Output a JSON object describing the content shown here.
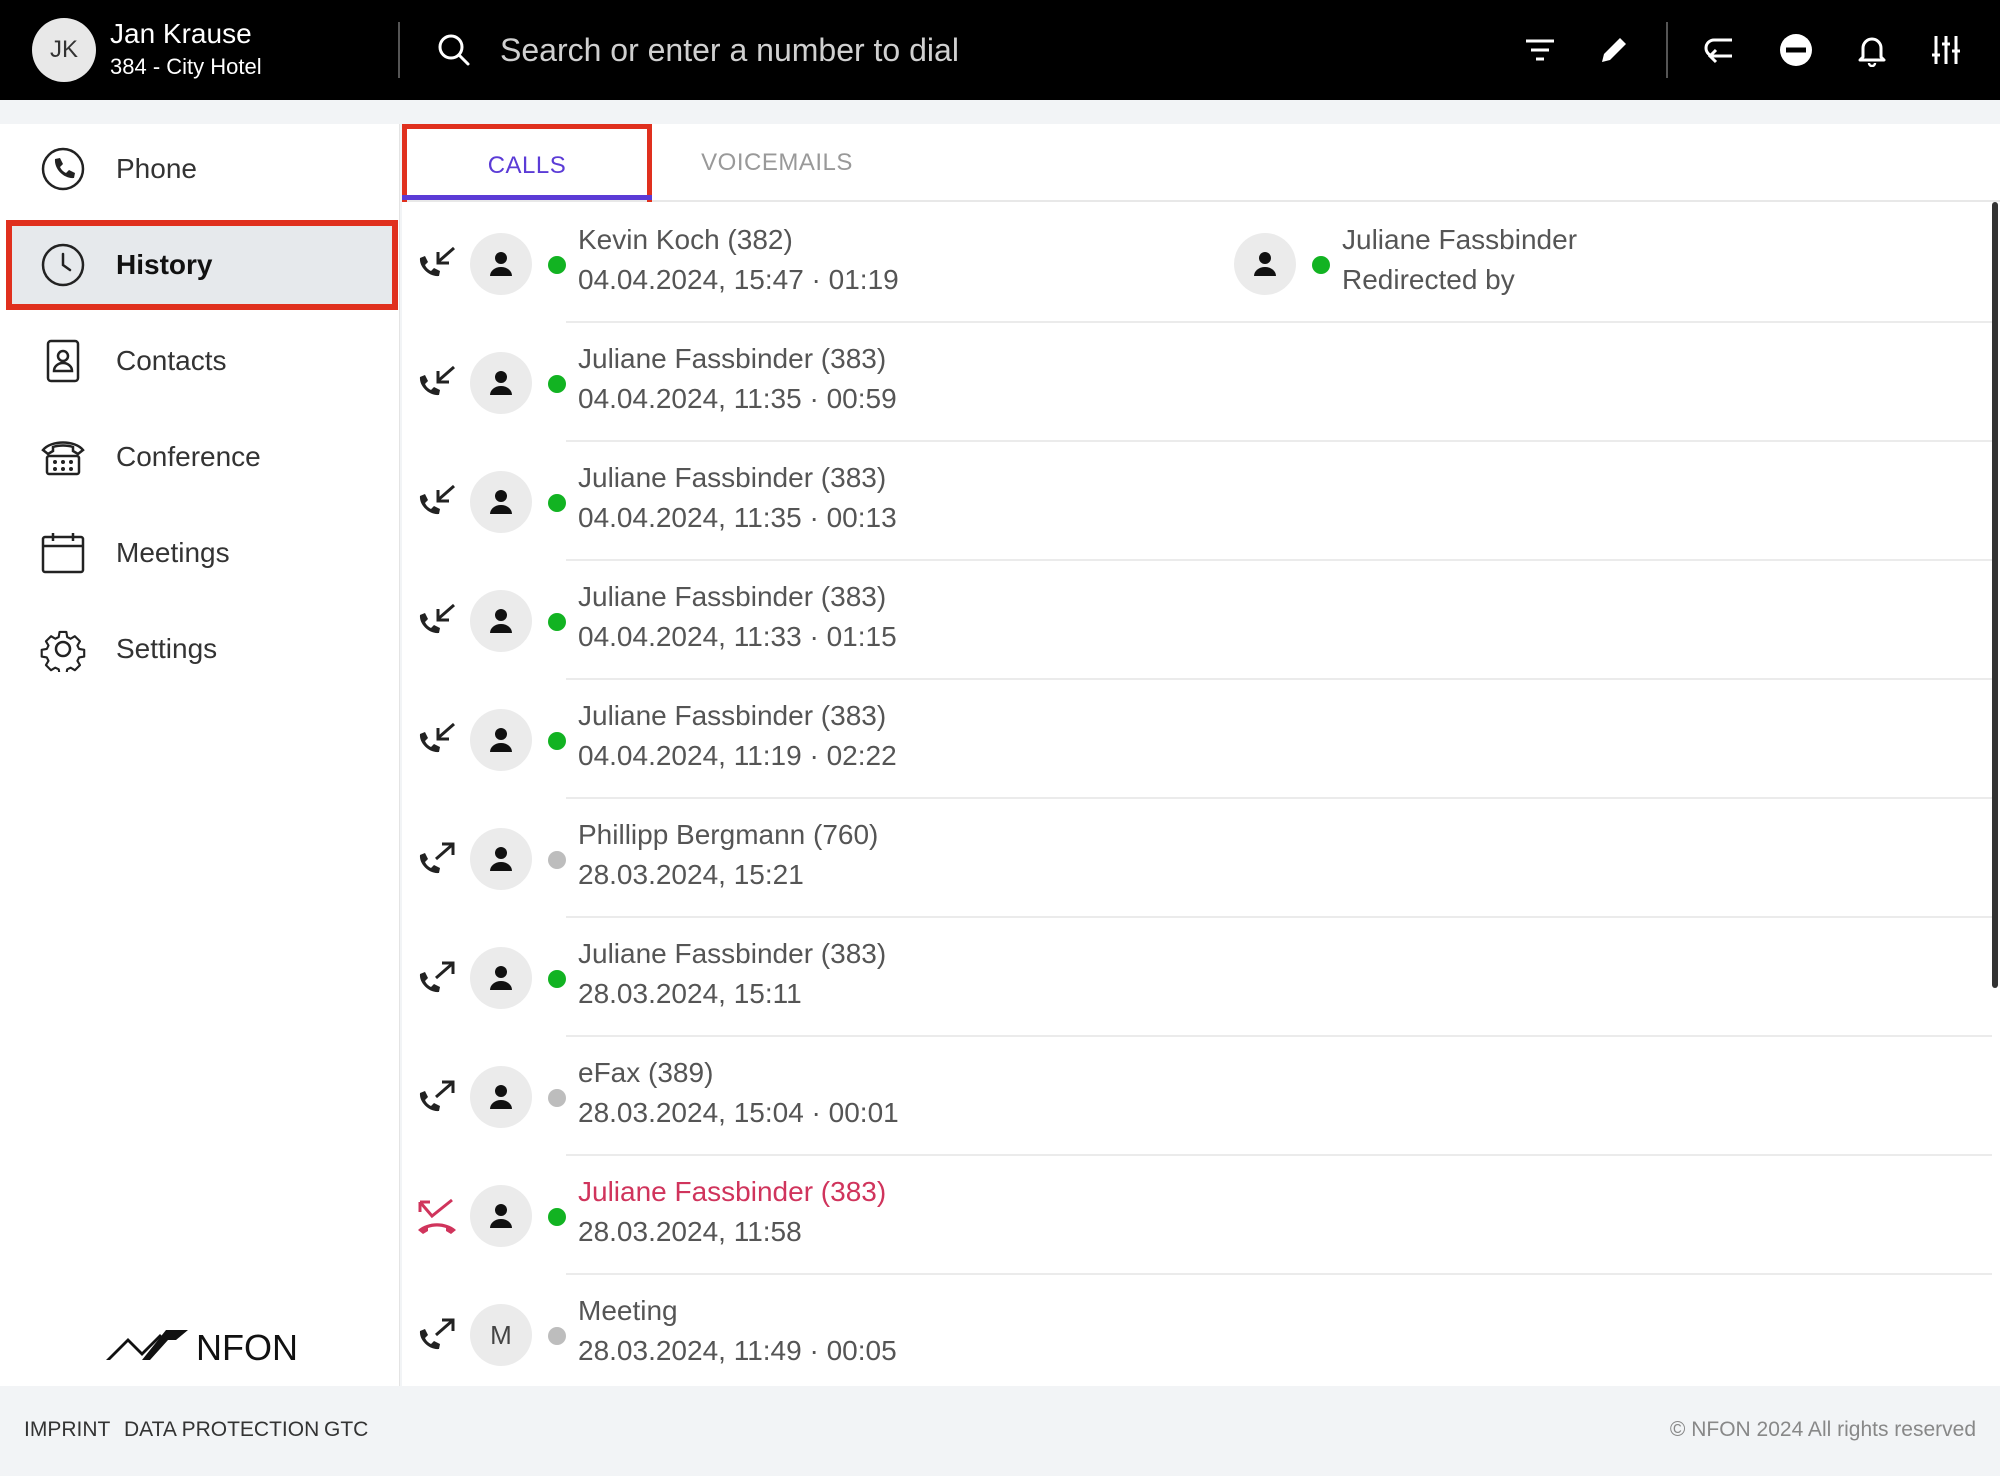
{
  "user": {
    "initials": "JK",
    "name": "Jan Krause",
    "line": "384 - City Hotel"
  },
  "search": {
    "placeholder": "Search or enter a number to dial"
  },
  "toolbar": {
    "icons": [
      "filter-icon",
      "edit-icon",
      "redirect-icon",
      "do-not-disturb-icon",
      "bell-icon",
      "sliders-icon"
    ]
  },
  "sidebar": {
    "items": [
      {
        "label": "Phone",
        "icon": "phone-icon"
      },
      {
        "label": "History",
        "icon": "clock-icon",
        "active": true
      },
      {
        "label": "Contacts",
        "icon": "contact-card-icon"
      },
      {
        "label": "Conference",
        "icon": "conference-phone-icon"
      },
      {
        "label": "Meetings",
        "icon": "calendar-icon"
      },
      {
        "label": "Settings",
        "icon": "gear-icon"
      }
    ],
    "logo_text": "NFON"
  },
  "tabs": [
    {
      "label": "CALLS",
      "active": true
    },
    {
      "label": "VOICEMAILS",
      "active": false
    }
  ],
  "calls": [
    {
      "direction": "incoming",
      "caller": "Kevin Koch (382)",
      "meta": "04.04.2024, 15:47 · 01:19",
      "status": "online",
      "avatar": "person",
      "redirect": {
        "name": "Juliane Fassbinder",
        "note": "Redirected by",
        "status": "online"
      }
    },
    {
      "direction": "incoming",
      "caller": "Juliane Fassbinder (383)",
      "meta": "04.04.2024, 11:35 · 00:59",
      "status": "online",
      "avatar": "person"
    },
    {
      "direction": "incoming",
      "caller": "Juliane Fassbinder (383)",
      "meta": "04.04.2024, 11:35 · 00:13",
      "status": "online",
      "avatar": "person"
    },
    {
      "direction": "incoming",
      "caller": "Juliane Fassbinder (383)",
      "meta": "04.04.2024, 11:33 · 01:15",
      "status": "online",
      "avatar": "person"
    },
    {
      "direction": "incoming",
      "caller": "Juliane Fassbinder (383)",
      "meta": "04.04.2024, 11:19 · 02:22",
      "status": "online",
      "avatar": "person"
    },
    {
      "direction": "outgoing",
      "caller": "Phillipp Bergmann (760)",
      "meta": "28.03.2024, 15:21",
      "status": "offline",
      "avatar": "person"
    },
    {
      "direction": "outgoing",
      "caller": "Juliane Fassbinder (383)",
      "meta": "28.03.2024, 15:11",
      "status": "online",
      "avatar": "person"
    },
    {
      "direction": "outgoing",
      "caller": "eFax (389)",
      "meta": "28.03.2024, 15:04 · 00:01",
      "status": "offline",
      "avatar": "person"
    },
    {
      "direction": "missed",
      "caller": "Juliane Fassbinder (383)",
      "meta": "28.03.2024, 11:58",
      "status": "online",
      "avatar": "person"
    },
    {
      "direction": "outgoing",
      "caller": "Meeting",
      "meta": "28.03.2024, 11:49 · 00:05",
      "status": "offline",
      "avatar": "M"
    }
  ],
  "footer": {
    "imprint": "IMPRINT",
    "data_protection": "DATA PROTECTION",
    "gtc": "GTC",
    "copyright": "© NFON 2024 All rights reserved"
  },
  "colors": {
    "accent": "#5b3bd6",
    "highlight": "#e0301e",
    "online": "#12b322",
    "offline": "#bdbdbd",
    "missed": "#d0345c"
  }
}
